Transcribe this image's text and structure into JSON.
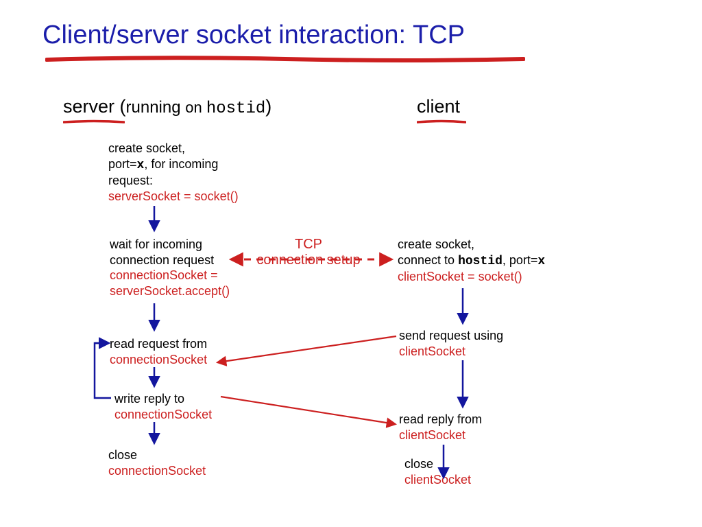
{
  "title": "Client/server socket interaction: TCP",
  "server_header_prefix": "server",
  "server_header_paren_open": " (",
  "server_header_running": "running ",
  "server_header_on": "on ",
  "server_header_hostid": "hostid",
  "server_header_paren_close": ")",
  "client_header": "client",
  "server": {
    "s1_l1": "create socket,",
    "s1_l2a": "port=",
    "s1_l2b": "x",
    "s1_l2c": ", for incoming",
    "s1_l3": "request:",
    "s1_code": "serverSocket = socket()",
    "s2_l1": "wait for incoming",
    "s2_l2": "connection request",
    "s2_code_l1": "connectionSocket =",
    "s2_code_l2": "serverSocket.accept()",
    "s3_l1": "read request from",
    "s3_code": "connectionSocket",
    "s4_l1": "write reply to",
    "s4_code": "connectionSocket",
    "s5_l1": "close",
    "s5_code": "connectionSocket"
  },
  "client": {
    "c1_l1": "create socket,",
    "c1_l2a": "connect to ",
    "c1_l2b": "hostid",
    "c1_l2c": ", port=",
    "c1_l2d": "x",
    "c1_code": "clientSocket = socket()",
    "c2_l1": "send request using",
    "c2_code": "clientSocket",
    "c3_l1": "read reply from",
    "c3_code": "clientSocket",
    "c4_l1": "close",
    "c4_code": "clientSocket"
  },
  "tcp_line1": "TCP",
  "tcp_line2": "connection setup",
  "colors": {
    "title_blue": "#1b1eaa",
    "accent_red": "#cc1f1f",
    "arrow_blue": "#13169e"
  }
}
